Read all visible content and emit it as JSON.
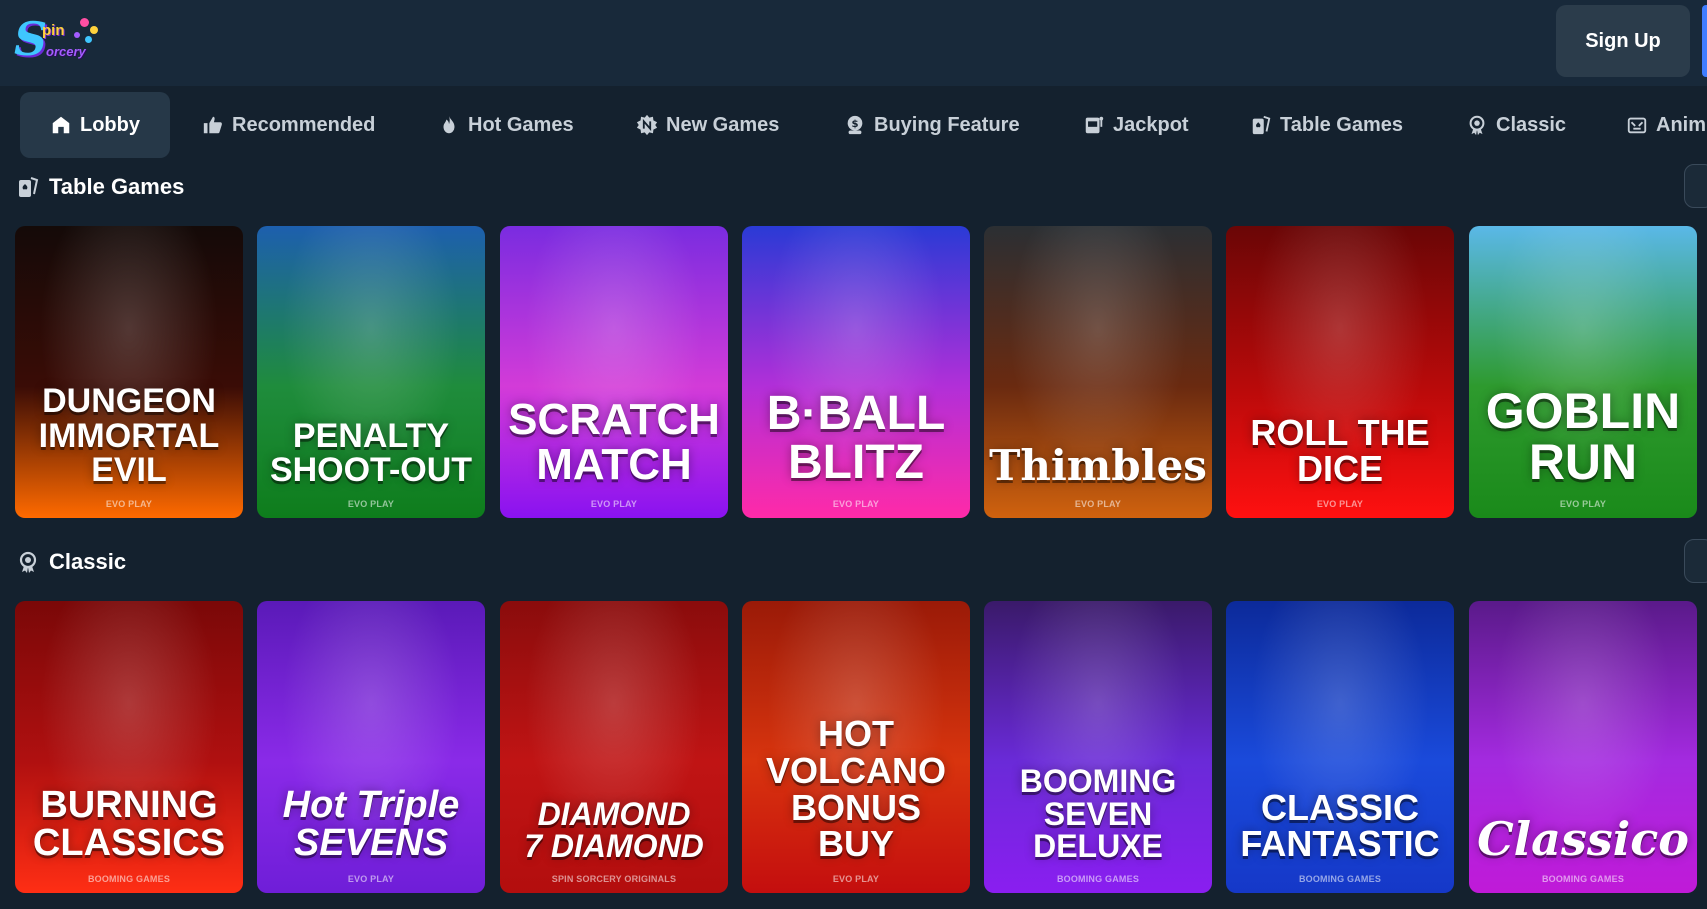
{
  "header": {
    "logo": {
      "big_letter": "S",
      "line1": "pin",
      "line2": "orcery"
    },
    "signup_label": "Sign Up"
  },
  "categories": [
    {
      "label": "Lobby",
      "icon": "home-icon",
      "active": true
    },
    {
      "label": "Recommended",
      "icon": "thumbs-up-icon"
    },
    {
      "label": "Hot Games",
      "icon": "flame-icon"
    },
    {
      "label": "New Games",
      "icon": "new-badge-icon"
    },
    {
      "label": "Buying Feature",
      "icon": "coin-icon"
    },
    {
      "label": "Jackpot",
      "icon": "slot-machine-icon"
    },
    {
      "label": "Table Games",
      "icon": "playing-cards-icon"
    },
    {
      "label": "Classic",
      "icon": "award-icon"
    },
    {
      "label": "Anim",
      "icon": "animal-icon"
    }
  ],
  "sections": [
    {
      "title": "Table Games",
      "icon": "playing-cards-icon",
      "games": [
        {
          "name": "DUNGEON\nIMMORTAL EVIL",
          "provider": "EVO PLAY",
          "colors": [
            "#140a08",
            "#3a0c06",
            "#ff6a00"
          ]
        },
        {
          "name": "PENALTY\nSHOOT-OUT",
          "provider": "EVO PLAY",
          "colors": [
            "#1d5fae",
            "#1f8c3c",
            "#0e7d1c"
          ]
        },
        {
          "name": "SCRATCH\nMATCH",
          "provider": "EVO PLAY",
          "colors": [
            "#7a2ce0",
            "#d33bd8",
            "#8a12f0"
          ]
        },
        {
          "name": "B·BALL\nBLITZ",
          "provider": "EVO PLAY",
          "colors": [
            "#2a3ad6",
            "#b22fd8",
            "#ff2aa8"
          ]
        },
        {
          "name": "Thimbles",
          "provider": "EVO PLAY",
          "colors": [
            "#2b2f33",
            "#6a2a10",
            "#d0620e"
          ]
        },
        {
          "name": "ROLL THE DICE",
          "provider": "EVO PLAY",
          "colors": [
            "#6a0606",
            "#b80a0a",
            "#ff1010"
          ]
        },
        {
          "name": "GOBLIN\nRUN",
          "provider": "EVO PLAY",
          "colors": [
            "#5ab8e8",
            "#2e9a2e",
            "#1a8a1a"
          ]
        }
      ]
    },
    {
      "title": "Classic",
      "icon": "award-icon",
      "games": [
        {
          "name": "BURNING\nCLASSICS",
          "provider": "BOOMING GAMES",
          "colors": [
            "#7a0808",
            "#b01010",
            "#ff2e14"
          ]
        },
        {
          "name": "Hot Triple\nSEVENS",
          "provider": "EVO PLAY",
          "colors": [
            "#5a1ab8",
            "#8a2ae8",
            "#6f1ed8"
          ]
        },
        {
          "name": "DIAMOND\n7 DIAMOND",
          "provider": "SPIN SORCERY ORIGINALS",
          "colors": [
            "#8a0c0c",
            "#c01414",
            "#b30e0e"
          ]
        },
        {
          "name": "HOT\nVOLCANO\nBONUS BUY",
          "provider": "EVO PLAY",
          "colors": [
            "#9a1a08",
            "#d8340e",
            "#c40e0e"
          ]
        },
        {
          "name": "BOOMING\nSEVEN DELUXE",
          "provider": "BOOMING GAMES",
          "colors": [
            "#3a1a6a",
            "#6a2ad8",
            "#8a1ef0"
          ]
        },
        {
          "name": "CLASSIC\nFANTASTIC",
          "provider": "BOOMING GAMES",
          "colors": [
            "#0c2a9a",
            "#1a4adb",
            "#1538c8"
          ]
        },
        {
          "name": "Classico",
          "provider": "BOOMING GAMES",
          "colors": [
            "#5a1a8a",
            "#a42ae0",
            "#c01ad8"
          ]
        }
      ]
    }
  ]
}
